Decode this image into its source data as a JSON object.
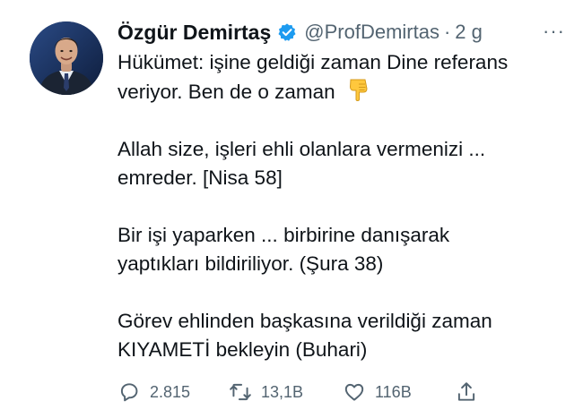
{
  "tweet": {
    "author": {
      "display_name": "Özgür Demirtaş",
      "handle": "@ProfDemirtas",
      "verified": true
    },
    "separator": "·",
    "age": "2 g",
    "more_label": "···",
    "paragraphs": [
      {
        "line1": "Hükümet: işine geldiği zaman Dine referans",
        "line2": "veriyor. Ben de o zaman"
      },
      {
        "line1": "Allah size, işleri ehli olanlara vermenizi ...",
        "line2": "emreder. [Nisa 58]"
      },
      {
        "line1": "Bir işi yaparken ... birbirine danışarak",
        "line2": "yaptıkları bildiriliyor. (Şura 38)"
      },
      {
        "line1": "Görev ehlinden başkasına verildiği zaman",
        "line2": "KIYAMETİ bekleyin (Buhari)"
      }
    ],
    "emoji": "pointing-down-hand",
    "actions": {
      "reply_count": "2.815",
      "retweet_count": "13,1B",
      "like_count": "116B"
    },
    "colors": {
      "text": "#0f1419",
      "muted": "#536471",
      "verified_blue": "#1d9bf0"
    }
  }
}
